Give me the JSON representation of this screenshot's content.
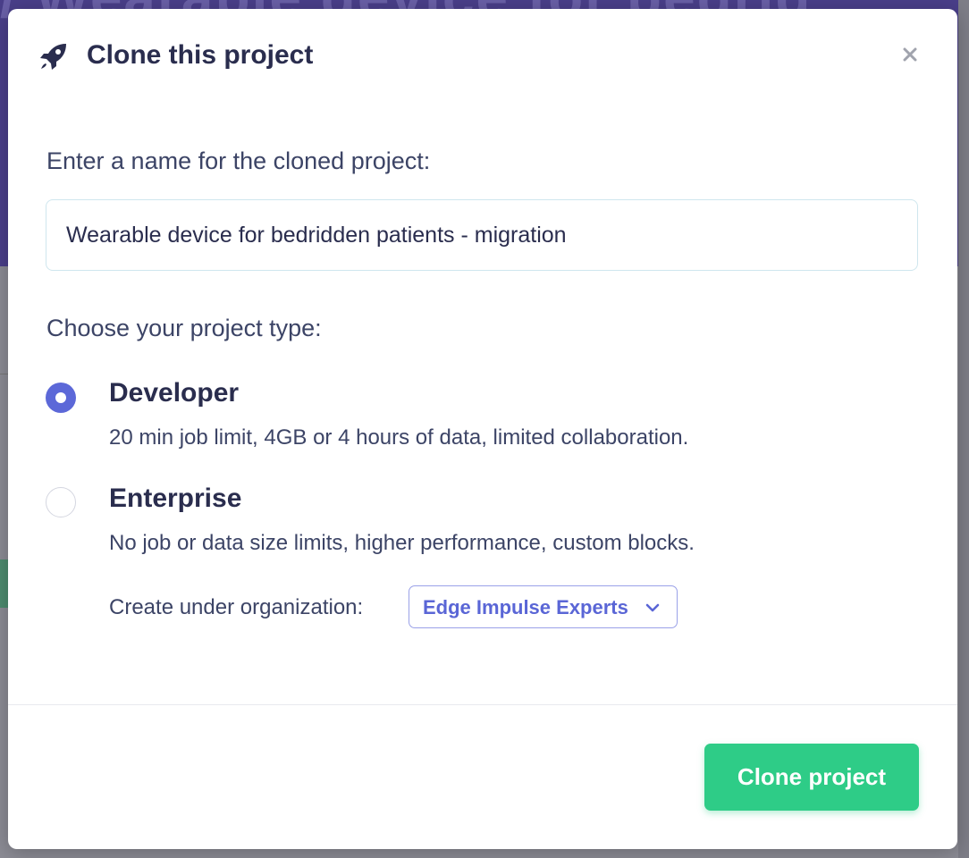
{
  "background": {
    "project_title": "/ Wearable device for bedrid"
  },
  "modal": {
    "title": "Clone this project",
    "icons": {
      "header": "rocket-icon",
      "close": "close-icon",
      "dropdown": "chevron-down-icon"
    },
    "name_label": "Enter a name for the cloned project:",
    "name_value": "Wearable device for bedridden patients - migration",
    "type_label": "Choose your project type:",
    "options": [
      {
        "title": "Developer",
        "description": "20 min job limit, 4GB or 4 hours of data, limited collaboration.",
        "selected": true
      },
      {
        "title": "Enterprise",
        "description": "No job or data size limits, higher performance, custom blocks.",
        "selected": false
      }
    ],
    "org_label": "Create under organization:",
    "org_value": "Edge Impulse Experts",
    "clone_button": "Clone project"
  },
  "colors": {
    "accent": "#5c68d8",
    "primary_button": "#2ecc87",
    "heading": "#2a2d4e",
    "body_text": "#3c4466",
    "header_background": "#4a3f8a"
  }
}
